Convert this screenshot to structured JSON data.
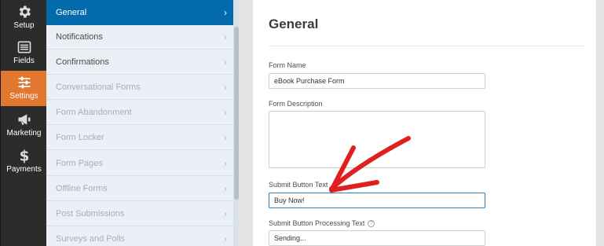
{
  "rail": {
    "items": [
      {
        "label": "Setup",
        "icon": "gear-icon"
      },
      {
        "label": "Fields",
        "icon": "fields-list-icon"
      },
      {
        "label": "Settings",
        "icon": "sliders-icon",
        "active": true
      },
      {
        "label": "Marketing",
        "icon": "megaphone-icon"
      },
      {
        "label": "Payments",
        "icon": "dollar-icon"
      }
    ]
  },
  "panel": {
    "items": [
      {
        "label": "General",
        "state": "active"
      },
      {
        "label": "Notifications",
        "state": "normal"
      },
      {
        "label": "Confirmations",
        "state": "normal"
      },
      {
        "label": "Conversational Forms",
        "state": "disabled"
      },
      {
        "label": "Form Abandonment",
        "state": "disabled"
      },
      {
        "label": "Form Locker",
        "state": "disabled"
      },
      {
        "label": "Form Pages",
        "state": "disabled"
      },
      {
        "label": "Offline Forms",
        "state": "disabled"
      },
      {
        "label": "Post Submissions",
        "state": "disabled"
      },
      {
        "label": "Surveys and Polls",
        "state": "disabled"
      }
    ],
    "chevron": "›"
  },
  "main": {
    "title": "General",
    "form_name_label": "Form Name",
    "form_name_value": "eBook Purchase Form",
    "form_description_label": "Form Description",
    "form_description_value": "",
    "submit_text_label": "Submit Button Text",
    "submit_text_value": "Buy Now!",
    "processing_text_label": "Submit Button Processing Text",
    "processing_text_value": "Sending...",
    "help_glyph": "?"
  },
  "colors": {
    "rail_bg": "#2c2c2c",
    "rail_active": "#e27730",
    "panel_bg": "#eaf0f6",
    "panel_active": "#036aab",
    "annotation_arrow": "#e02020"
  }
}
